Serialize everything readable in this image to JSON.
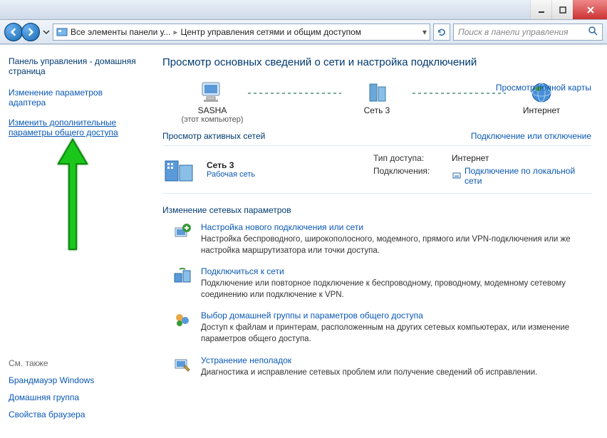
{
  "titlebar": {},
  "navbar": {
    "breadcrumb1": "Все элементы панели у...",
    "breadcrumb2": "Центр управления сетями и общим доступом",
    "search_placeholder": "Поиск в панели управления"
  },
  "sidebar": {
    "home": "Панель управления - домашняя страница",
    "link1": "Изменение параметров адаптера",
    "link2": "Изменить дополнительные параметры общего доступа",
    "see_also_hdr": "См. также",
    "see_also": [
      "Брандмауэр Windows",
      "Домашняя группа",
      "Свойства браузера"
    ]
  },
  "main": {
    "title": "Просмотр основных сведений о сети и настройка подключений",
    "full_map": "Просмотр полной карты",
    "map": {
      "node1": "SASHA",
      "node1_sub": "(этот компьютер)",
      "node2": "Сеть  3",
      "node3": "Интернет"
    },
    "active_header": "Просмотр активных сетей",
    "active_right_link": "Подключение или отключение",
    "active": {
      "name": "Сеть  3",
      "type": "Рабочая сеть",
      "access_label": "Тип доступа:",
      "access_value": "Интернет",
      "conn_label": "Подключения:",
      "conn_value": "Подключение по локальной сети"
    },
    "change_header": "Изменение сетевых параметров",
    "options": [
      {
        "title": "Настройка нового подключения или сети",
        "desc": "Настройка беспроводного, широкополосного, модемного, прямого или VPN-подключения или же настройка маршрутизатора или точки доступа."
      },
      {
        "title": "Подключиться к сети",
        "desc": "Подключение или повторное подключение к беспроводному, проводному, модемному сетевому соединению или подключение к VPN."
      },
      {
        "title": "Выбор домашней группы и параметров общего доступа",
        "desc": "Доступ к файлам и принтерам, расположенным на других сетевых компьютерах, или изменение параметров общего доступа."
      },
      {
        "title": "Устранение неполадок",
        "desc": "Диагностика и исправление сетевых проблем или получение сведений об исправлении."
      }
    ]
  }
}
